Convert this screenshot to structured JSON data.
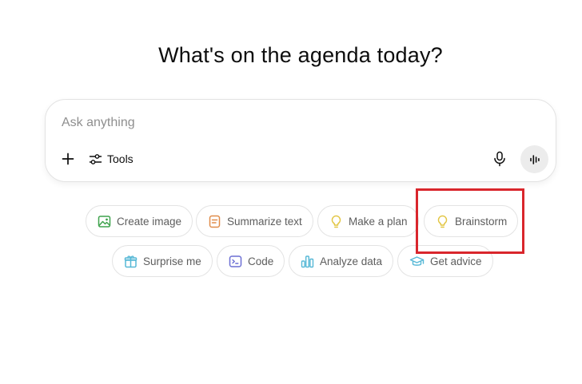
{
  "heading": "What's on the agenda today?",
  "composer": {
    "placeholder": "Ask anything",
    "value": "",
    "tools_label": "Tools",
    "icons": {
      "add": "plus-icon",
      "tools": "sliders-icon",
      "mic": "microphone-icon",
      "voice": "voice-waveform-icon"
    }
  },
  "suggestions": {
    "row1": [
      {
        "label": "Create image",
        "icon": "image-icon",
        "color": "#3fa34d"
      },
      {
        "label": "Summarize text",
        "icon": "document-icon",
        "color": "#e08c4a"
      },
      {
        "label": "Make a plan",
        "icon": "lightbulb-icon",
        "color": "#e2c541"
      },
      {
        "label": "Brainstorm",
        "icon": "lightbulb-icon",
        "color": "#e2c541"
      }
    ],
    "row2": [
      {
        "label": "Surprise me",
        "icon": "gift-icon",
        "color": "#56b8d6"
      },
      {
        "label": "Code",
        "icon": "terminal-icon",
        "color": "#6c6fd4"
      },
      {
        "label": "Analyze data",
        "icon": "bar-chart-icon",
        "color": "#56b8d6"
      },
      {
        "label": "Get advice",
        "icon": "graduation-cap-icon",
        "color": "#56b8d6"
      }
    ]
  },
  "highlight_color": "#d9262c"
}
